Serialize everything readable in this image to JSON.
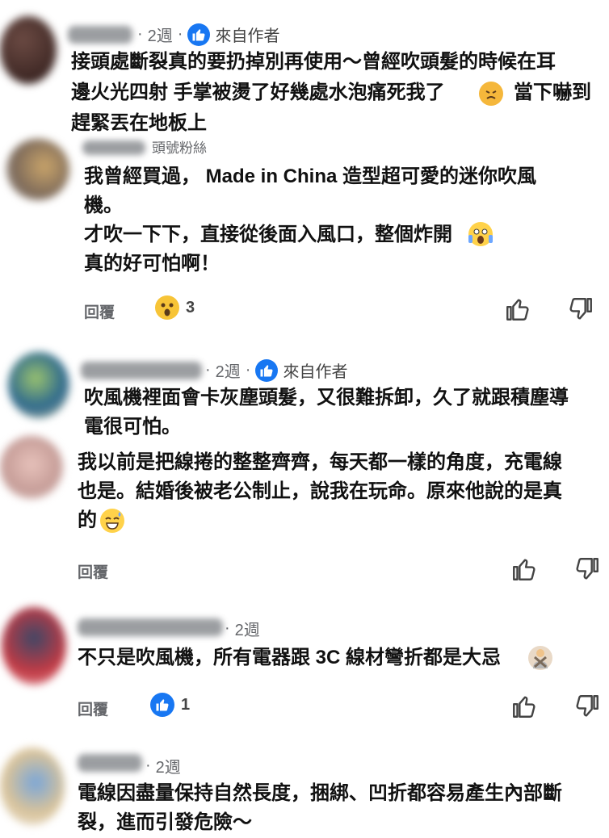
{
  "comments": [
    {
      "time": "2週",
      "author_label": "來自作者",
      "lines": [
        "接頭處斷裂真的要扔掉別再使用～曾經吹頭髮的時候在耳",
        "邊火光四射 手掌被燙了好幾處水泡痛死我了",
        "趕緊丟在地板上"
      ],
      "inline_after": "當下嚇到"
    },
    {
      "badge": "頭號粉絲",
      "lines": [
        "我曾經買過， Made in China 造型超可愛的迷你吹風",
        "機。",
        "才吹一下下，直接從後面入風口，整個炸開",
        "真的好可怕啊！"
      ],
      "reply_label": "回覆",
      "reaction_count": "3"
    },
    {
      "time": "2週",
      "author_label": "來自作者",
      "lines": [
        "吹風機裡面會卡灰塵頭髮，又很難拆卸，久了就跟積塵導",
        "電很可怕。"
      ]
    },
    {
      "lines": [
        "我以前是把線捲的整整齊齊，每天都一樣的角度，充電線",
        "也是。結婚後被老公制止，說我在玩命。原來他說的是真",
        "的"
      ],
      "reply_label": "回覆"
    },
    {
      "time": "2週",
      "lines": [
        "不只是吹風機，所有電器跟 3C 線材彎折都是大忌"
      ],
      "reply_label": "回覆",
      "reaction_count": "1"
    },
    {
      "time": "2週",
      "lines": [
        "電線因盡量保持自然長度，捆綁、凹折都容易產生內部斷",
        "裂，進而引發危險～"
      ]
    }
  ],
  "colors": {
    "accent": "#1877f2",
    "muted": "#65676b",
    "text": "#111111"
  }
}
